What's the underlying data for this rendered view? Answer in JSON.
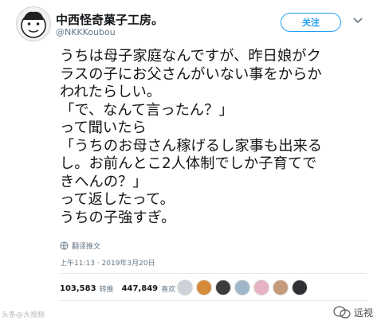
{
  "author": {
    "display_name": "中西怪奇菓子工房。",
    "handle": "@NKKKoubou",
    "avatar_icon": "cartoon-face-avatar"
  },
  "header": {
    "follow_label": "关注",
    "accent_color": "#1da1f2"
  },
  "tweet": {
    "lines": [
      "うちは母子家庭なんですが、昨日娘がク",
      "ラスの子にお父さんがいない事をからか",
      "われたらしい。",
      "「で、なんて言ったん？」",
      "って聞いたら",
      "「うちのお母さん稼げるし家事も出来る",
      "し。お前んとこ2人体制でしか子育てで",
      "きへんの？」",
      "って返したって。",
      "うちの子強すぎ。"
    ],
    "translate_label": "翻译推文",
    "timestamp": "上午11:13 · 2019年3月20日"
  },
  "stats": {
    "retweets_count": "103,583",
    "retweets_label": "转推",
    "likes_count": "447,849",
    "likes_label": "喜欢"
  },
  "watermarks": {
    "left": "头条@大视频",
    "right": "远视"
  }
}
